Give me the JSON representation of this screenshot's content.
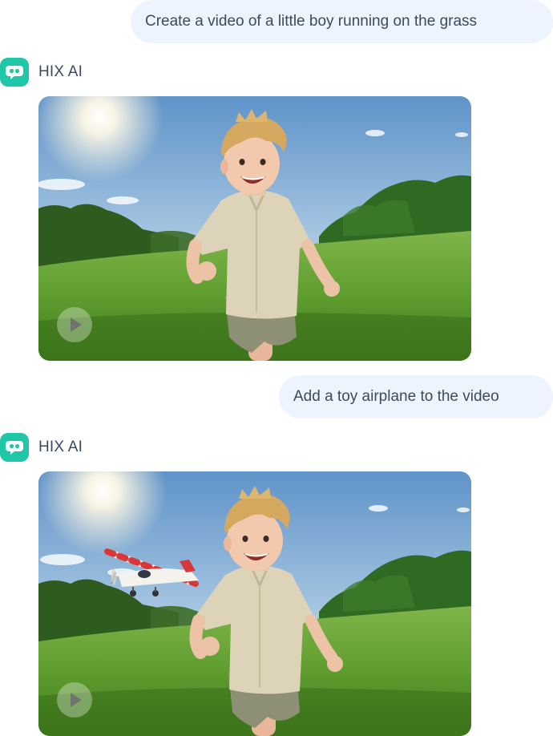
{
  "conversation": {
    "messages": [
      {
        "role": "user",
        "text": "Create a video of a little boy running on the grass"
      },
      {
        "role": "assistant",
        "name": "HIX AI",
        "content": "video",
        "icon": "play-icon"
      },
      {
        "role": "user",
        "text": "Add a toy airplane to the video"
      },
      {
        "role": "assistant",
        "name": "HIX AI",
        "content": "video",
        "icon": "play-icon"
      }
    ]
  },
  "theme": {
    "brand_color": "#1fc7a6",
    "user_bubble_bg": "#eef4fe",
    "text_color": "#3b4a5c"
  },
  "icons": {
    "bot_logo": "hix-ai-logo-icon",
    "video_control": "play-icon"
  }
}
